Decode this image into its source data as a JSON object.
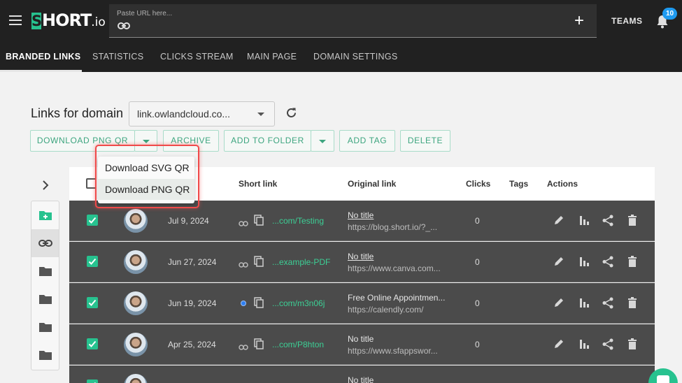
{
  "header": {
    "logo_text": "SHORT.io",
    "url_placeholder": "Paste URL here...",
    "teams_label": "TEAMS",
    "notification_count": "10",
    "add_symbol": "+"
  },
  "nav": {
    "tabs": [
      {
        "label": "BRANDED LINKS",
        "active": true
      },
      {
        "label": "STATISTICS"
      },
      {
        "label": "CLICKS STREAM"
      },
      {
        "label": "MAIN PAGE"
      },
      {
        "label": "DOMAIN SETTINGS"
      }
    ]
  },
  "domain": {
    "label": "Links for domain",
    "selected": "link.owlandcloud.co..."
  },
  "toolbar": {
    "download_png_qr": "DOWNLOAD PNG QR",
    "archive": "ARCHIVE",
    "add_to_folder": "ADD TO FOLDER",
    "add_tag": "ADD TAG",
    "delete": "DELETE"
  },
  "dropdown": {
    "items": [
      {
        "label": "Download SVG QR"
      },
      {
        "label": "Download PNG QR"
      }
    ]
  },
  "table": {
    "columns": [
      "Short link",
      "Original link",
      "Clicks",
      "Tags",
      "Actions"
    ],
    "rows": [
      {
        "date": "Jul 9, 2024",
        "short": "...com/Testing",
        "title": "No title",
        "url": "https://blog.short.io/?_...",
        "clicks": "0",
        "checked": true
      },
      {
        "date": "Jun 27, 2024",
        "short": "...example-PDF",
        "title": "No title",
        "url": "https://www.canva.com...",
        "clicks": "0",
        "checked": true
      },
      {
        "date": "Jun 19, 2024",
        "short": "...com/m3n06j",
        "title": "Free Online Appointmen...",
        "url": "https://calendly.com/",
        "clicks": "0",
        "checked": true
      },
      {
        "date": "Apr 25, 2024",
        "short": "...com/P8hton",
        "title": "No title",
        "url": "https://www.sfappswor...",
        "clicks": "0",
        "checked": true
      },
      {
        "date": "",
        "short": "",
        "title": "No title",
        "url": "",
        "clicks": "",
        "checked": true
      }
    ]
  },
  "colors": {
    "accent": "#27c28f",
    "topbar": "#212121",
    "row_bg": "#4b4b4b",
    "highlight": "#f04a4a",
    "badge": "#1e9af0"
  }
}
